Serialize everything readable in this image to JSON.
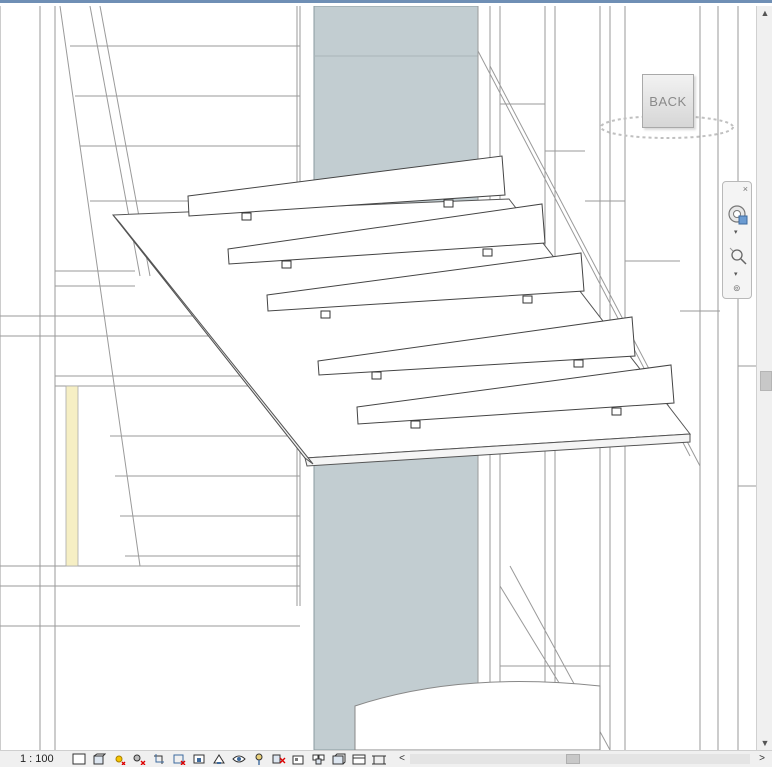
{
  "view": {
    "scale_label": "1 : 100",
    "viewcube_label": "BACK"
  },
  "icons": {
    "close": "×",
    "scroll_up": "▲",
    "scroll_down": "▼",
    "scroll_left": "<",
    "scroll_right": ">",
    "dropdown": "▾",
    "grip": "⊚"
  },
  "colors": {
    "column_fill": "#c2cdd1",
    "model_line": "#7a7a7a",
    "title_accent": "#6f8fb5",
    "beam_highlight": "#f6efc4"
  },
  "toolbar": [
    {
      "name": "detail-level-icon"
    },
    {
      "name": "visual-style-icon"
    },
    {
      "name": "sun-path-icon"
    },
    {
      "name": "shadows-icon"
    },
    {
      "name": "crop-view-icon"
    },
    {
      "name": "show-crop-region-icon"
    },
    {
      "name": "unlock-3d-view-icon"
    },
    {
      "name": "temporary-hide-isolate-icon"
    },
    {
      "name": "reveal-hidden-elements-icon"
    },
    {
      "name": "analytical-model-icon"
    },
    {
      "name": "highlight-displacement-icon"
    },
    {
      "name": "reveal-constraints-icon"
    },
    {
      "name": "worksharing-display-icon"
    },
    {
      "name": "temporary-view-properties-icon"
    },
    {
      "name": "show-render-dialog-icon"
    },
    {
      "name": "hide-analytical-icon"
    }
  ]
}
